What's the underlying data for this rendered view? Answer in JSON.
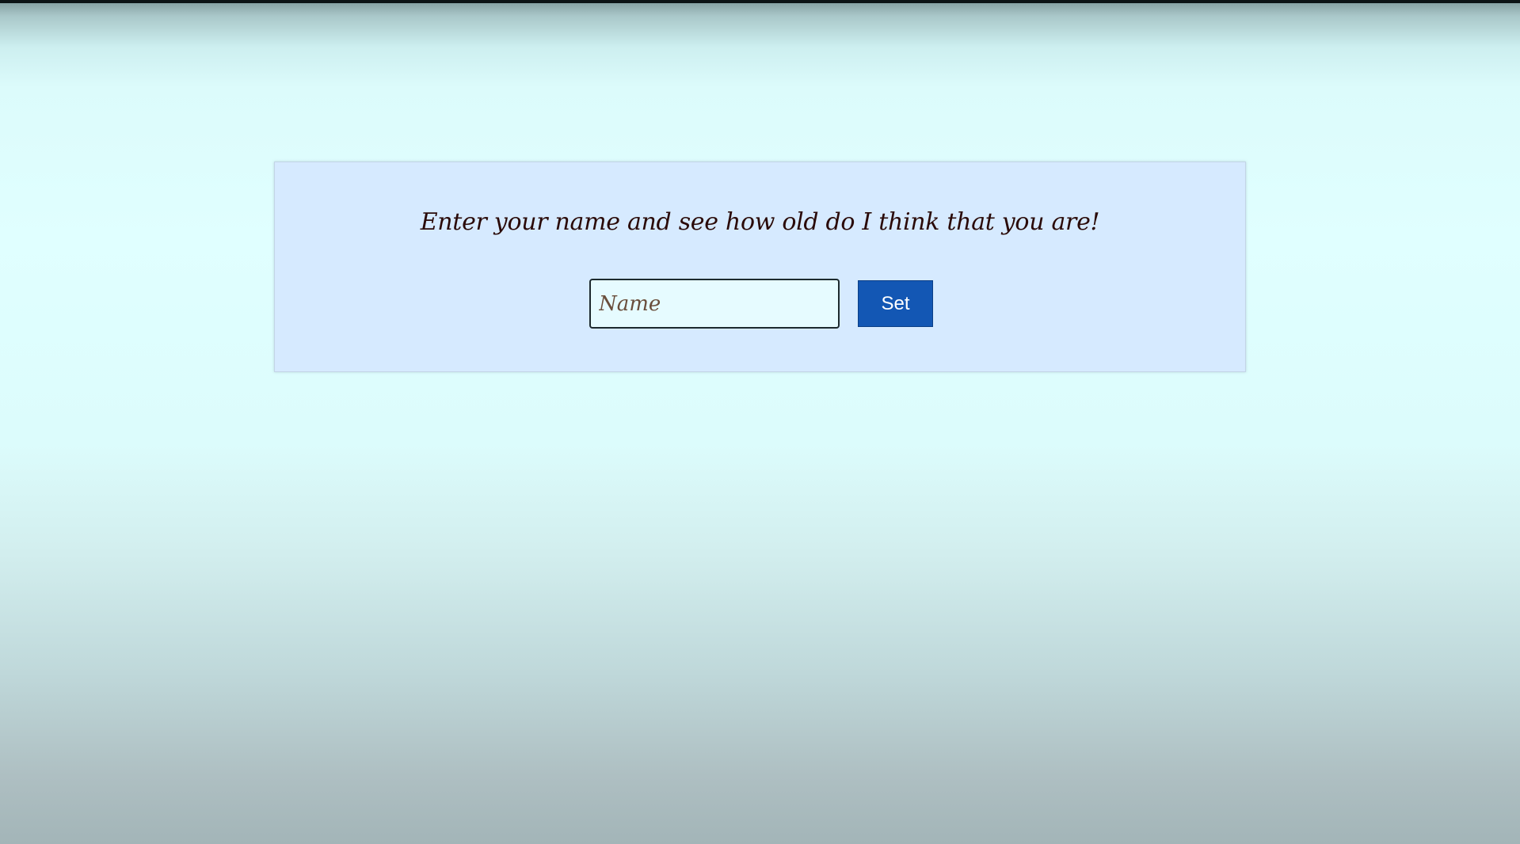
{
  "form": {
    "prompt": "Enter your name and see how old do I think that you are!",
    "name_input": {
      "value": "",
      "placeholder": "Name"
    },
    "set_label": "Set"
  },
  "colors": {
    "card_background": "#d6eaff",
    "button_background": "#1357b4",
    "prompt_text": "#2a0a08"
  }
}
